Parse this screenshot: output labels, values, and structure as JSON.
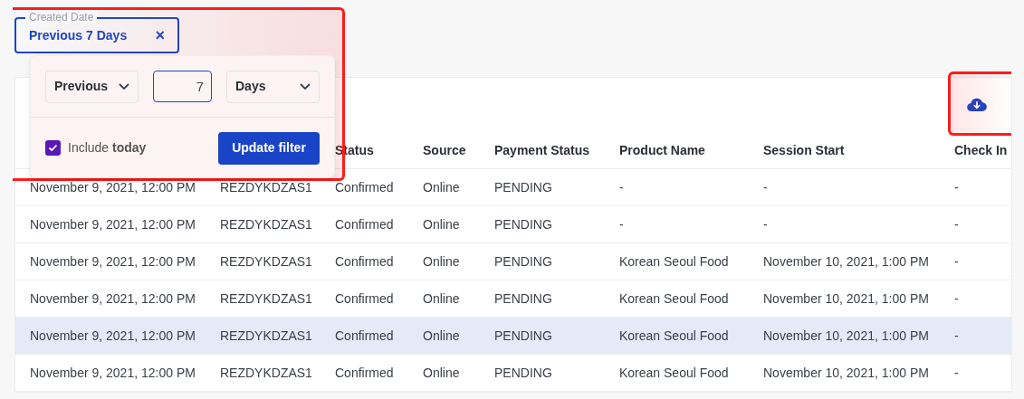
{
  "filter_chip": {
    "label": "Created Date",
    "value": "Previous 7 Days",
    "clear": "×"
  },
  "popover": {
    "direction": "Previous",
    "amount": "7",
    "unit": "Days",
    "include": {
      "label": "Include **today**",
      "checked": true
    },
    "update_button": "Update filter"
  },
  "table": {
    "columns": [
      "",
      "",
      "Status",
      "Source",
      "Payment Status",
      "Product Name",
      "Session Start",
      "Check In"
    ],
    "rows": [
      {
        "hovered": false,
        "cells": [
          "November 9, 2021, 12:00 PM",
          "REZDYKDZAS1",
          "Confirmed",
          "Online",
          "PENDING",
          "-",
          "-",
          "-"
        ]
      },
      {
        "hovered": false,
        "cells": [
          "November 9, 2021, 12:00 PM",
          "REZDYKDZAS1",
          "Confirmed",
          "Online",
          "PENDING",
          "-",
          "-",
          "-"
        ]
      },
      {
        "hovered": false,
        "cells": [
          "November 9, 2021, 12:00 PM",
          "REZDYKDZAS1",
          "Confirmed",
          "Online",
          "PENDING",
          "Korean Seoul Food",
          "November 10, 2021, 1:00 PM",
          "-"
        ]
      },
      {
        "hovered": false,
        "cells": [
          "November 9, 2021, 12:00 PM",
          "REZDYKDZAS1",
          "Confirmed",
          "Online",
          "PENDING",
          "Korean Seoul Food",
          "November 10, 2021, 1:00 PM",
          "-"
        ]
      },
      {
        "hovered": true,
        "cells": [
          "November 9, 2021, 12:00 PM",
          "REZDYKDZAS1",
          "Confirmed",
          "Online",
          "PENDING",
          "Korean Seoul Food",
          "November 10, 2021, 1:00 PM",
          "-"
        ]
      },
      {
        "hovered": false,
        "cells": [
          "November 9, 2021, 12:00 PM",
          "REZDYKDZAS1",
          "Confirmed",
          "Online",
          "PENDING",
          "Korean Seoul Food",
          "November 10, 2021, 1:00 PM",
          "-"
        ]
      }
    ]
  }
}
